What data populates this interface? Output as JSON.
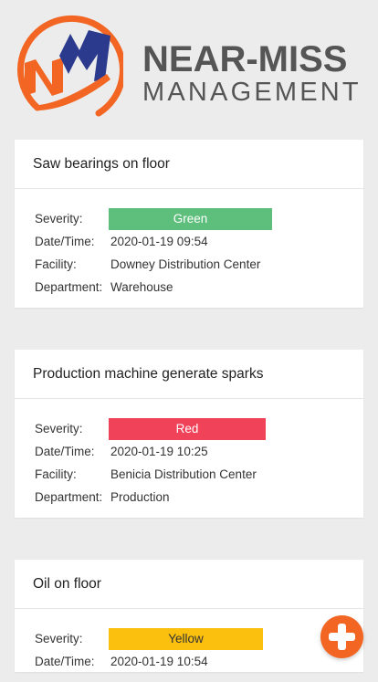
{
  "brand": {
    "line1": "NEAR-MISS",
    "line2": "MANAGEMENT",
    "colors": {
      "orange": "#f26522",
      "navy": "#2b3a8c",
      "text_gray": "#555555"
    }
  },
  "labels": {
    "severity": "Severity:",
    "datetime": "Date/Time:",
    "facility": "Facility:",
    "department": "Department:"
  },
  "reports": [
    {
      "title": "Saw bearings on floor",
      "severity": "Green",
      "severity_color": "#5dbf7b",
      "datetime": "2020-01-19 09:54",
      "facility": "Downey Distribution Center",
      "department": "Warehouse"
    },
    {
      "title": "Production machine generate sparks",
      "severity": "Red",
      "severity_color": "#f0435a",
      "datetime": "2020-01-19 10:25",
      "facility": "Benicia Distribution Center",
      "department": "Production"
    },
    {
      "title": "Oil on floor",
      "severity": "Yellow",
      "severity_color": "#fbbf0e",
      "datetime": "2020-01-19 10:54"
    }
  ],
  "fab": {
    "icon": "plus-icon",
    "color": "#f26522"
  }
}
